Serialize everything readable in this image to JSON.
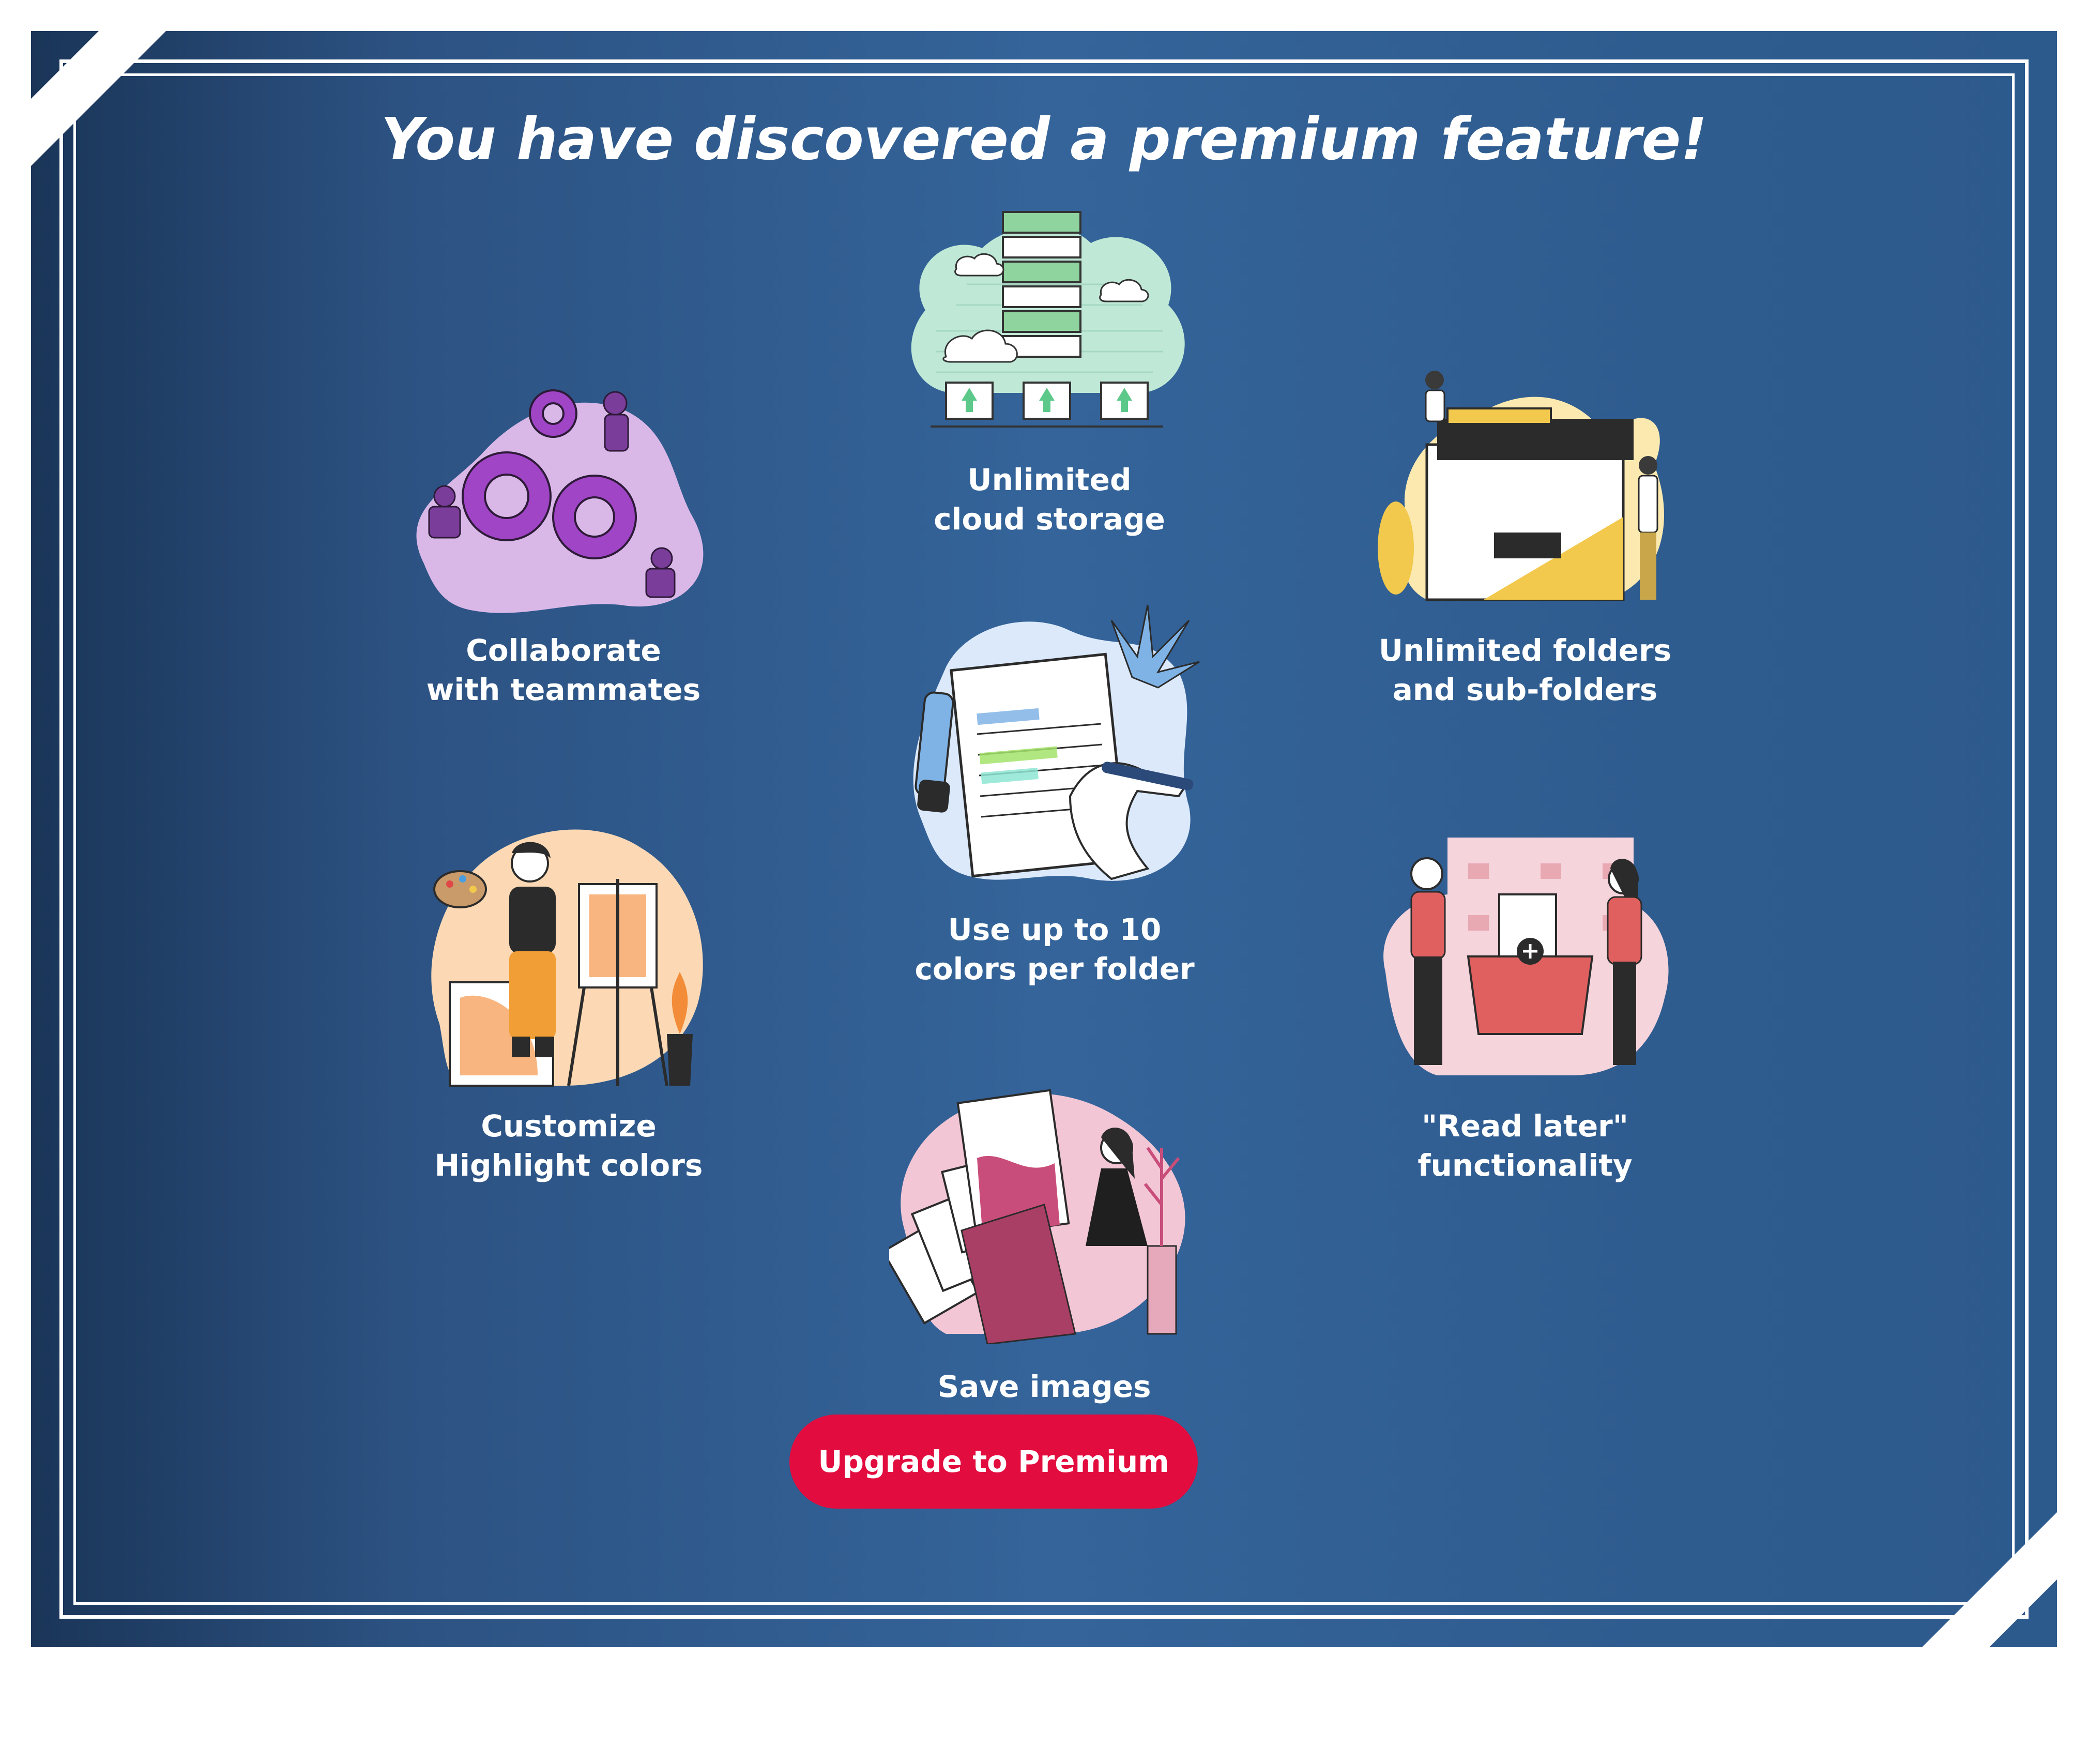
{
  "title": "You have discovered a premium feature!",
  "features": [
    {
      "id": "cloud",
      "lines": [
        "Unlimited",
        "cloud storage"
      ],
      "icon": "cloud-storage-illustration"
    },
    {
      "id": "collaborate",
      "lines": [
        "Collaborate",
        "with teammates"
      ],
      "icon": "teamwork-gears-illustration"
    },
    {
      "id": "folders",
      "lines": [
        "Unlimited folders",
        "and sub-folders"
      ],
      "icon": "folders-illustration"
    },
    {
      "id": "colors",
      "lines": [
        "Use up to 10",
        "colors per folder"
      ],
      "icon": "notebook-highlight-illustration"
    },
    {
      "id": "highlight",
      "lines": [
        "Customize",
        "Highlight colors"
      ],
      "icon": "painter-illustration"
    },
    {
      "id": "readlater",
      "lines": [
        "\"Read later\"",
        "functionality"
      ],
      "icon": "read-later-illustration"
    },
    {
      "id": "images",
      "lines": [
        "Save images"
      ],
      "icon": "save-images-illustration"
    }
  ],
  "cta": {
    "label": "Upgrade to Premium"
  },
  "colors": {
    "accent": "#e20c3f",
    "background": "#2f5c8f"
  }
}
